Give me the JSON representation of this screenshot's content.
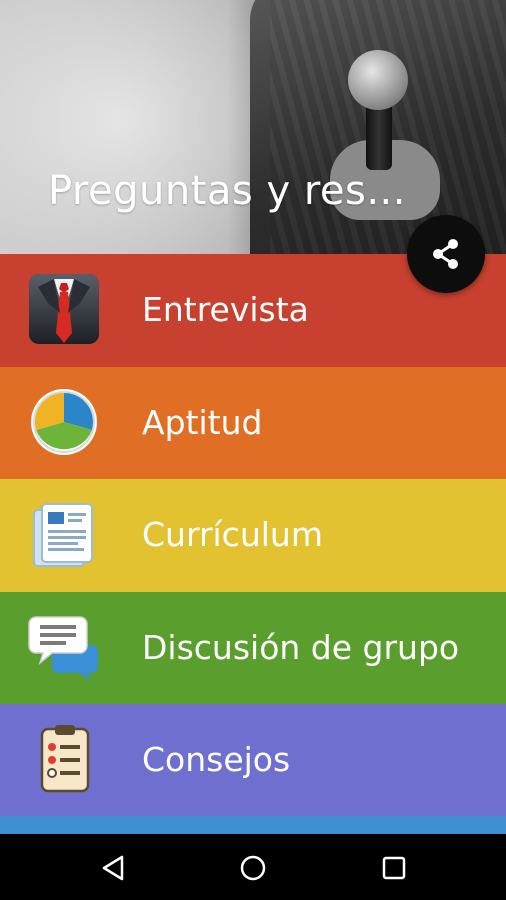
{
  "header": {
    "title": "Preguntas y res..."
  },
  "share_button": {
    "icon": "share-icon"
  },
  "menu": {
    "items": [
      {
        "label": "Entrevista",
        "color": "#c8402f",
        "icon": "suit-tie-icon"
      },
      {
        "label": "Aptitud",
        "color": "#e06f25",
        "icon": "pie-chart-icon"
      },
      {
        "label": "Currículum",
        "color": "#e3c232",
        "icon": "resume-document-icon"
      },
      {
        "label": "Discusión de grupo",
        "color": "#5a9f2e",
        "icon": "chat-bubbles-icon"
      },
      {
        "label": "Consejos",
        "color": "#6f6fd0",
        "icon": "checklist-clipboard-icon"
      }
    ],
    "partial_next_color": "#3f8fd0"
  },
  "navbar": {
    "back": "back-triangle-icon",
    "home": "home-circle-icon",
    "recents": "recents-square-icon"
  }
}
